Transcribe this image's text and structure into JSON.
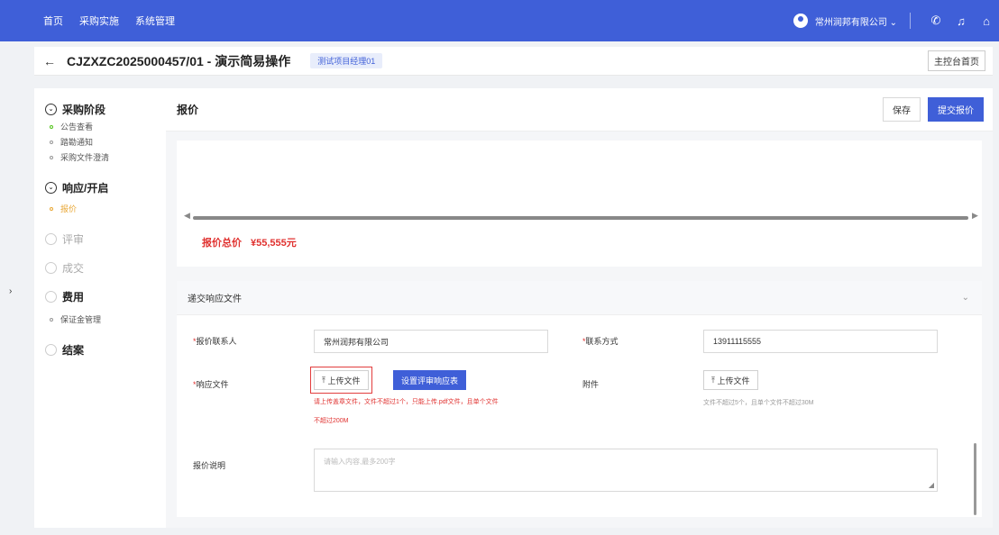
{
  "topnav": {
    "menu": [
      "首页",
      "采购实施",
      "系统管理"
    ],
    "company": "常州润邦有限公司 ⌄",
    "icons": [
      "phone-icon",
      "bell-icon",
      "home-icon"
    ]
  },
  "header": {
    "back": "←",
    "title": "CJZXZC2025000457/01 - 演示简易操作",
    "tag": "测试项目经理01",
    "home_button": "主控台首页"
  },
  "sidebar": {
    "toggle": "›",
    "stage1": {
      "label": "采购阶段",
      "items": [
        "公告查看",
        "踏勘通知",
        "采购文件澄清"
      ]
    },
    "stage2": {
      "label": "响应/开启",
      "items": [
        "报价"
      ]
    },
    "stage3": {
      "label": "评审"
    },
    "stage4": {
      "label": "成交"
    },
    "stage5": {
      "label": "费用",
      "items": [
        "保证金管理"
      ]
    },
    "stage6": {
      "label": "结案"
    }
  },
  "main": {
    "title": "报价",
    "save": "保存",
    "submit": "提交报价",
    "total_label": "报价总价",
    "total_value": "¥55,555元",
    "form": {
      "title": "递交响应文件",
      "contact_label": "报价联系人",
      "contact_value": "常州润邦有限公司",
      "phone_label": "联系方式",
      "phone_value": "13911115555",
      "response_label": "响应文件",
      "upload_label": "上传文件",
      "set_button": "设置评审响应表",
      "hint1": "请上传盖章文件，文件不超过1个，只能上传.pdf文件，且单个文件",
      "hint2": "不超过200M",
      "attach_label": "附件",
      "attach_upload": "上传文件",
      "attach_hint": "文件不超过5个，且单个文件不超过30M",
      "desc_label": "报价说明",
      "desc_placeholder": "请输入内容,最多200字"
    }
  },
  "colors": {
    "primary": "#3f5fd8",
    "danger": "#e0312f",
    "active": "#e8a735"
  }
}
